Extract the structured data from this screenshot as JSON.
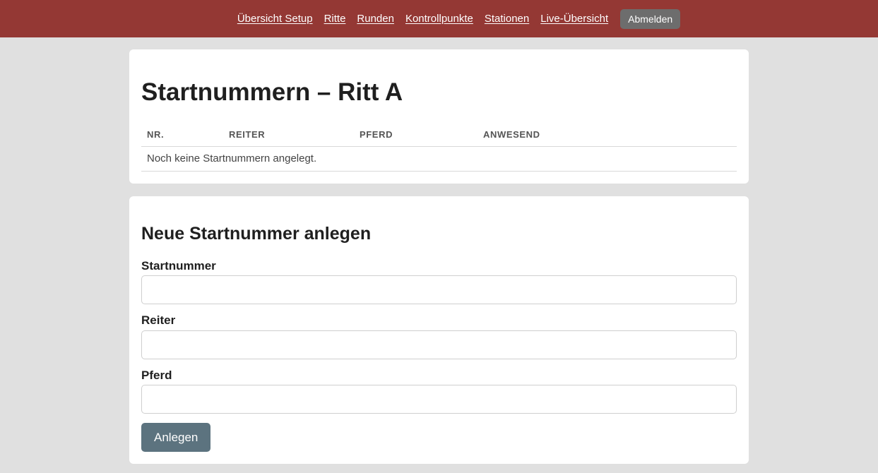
{
  "nav": {
    "links": [
      {
        "label": "Übersicht Setup"
      },
      {
        "label": "Ritte"
      },
      {
        "label": "Runden"
      },
      {
        "label": "Kontrollpunkte"
      },
      {
        "label": "Stationen"
      },
      {
        "label": "Live-Übersicht"
      }
    ],
    "logout_label": "Abmelden"
  },
  "list": {
    "title": "Startnummern – Ritt A",
    "columns": [
      "NR.",
      "REITER",
      "PFERD",
      "ANWESEND"
    ],
    "empty_message": "Noch keine Startnummern angelegt."
  },
  "form": {
    "title": "Neue Startnummer anlegen",
    "fields": [
      {
        "label": "Startnummer",
        "value": ""
      },
      {
        "label": "Reiter",
        "value": ""
      },
      {
        "label": "Pferd",
        "value": ""
      }
    ],
    "submit_label": "Anlegen"
  },
  "colors": {
    "topbar": "#943834",
    "logout_button": "#6d6d6d",
    "submit_button": "#5c737f",
    "background": "#e0e0e0"
  }
}
